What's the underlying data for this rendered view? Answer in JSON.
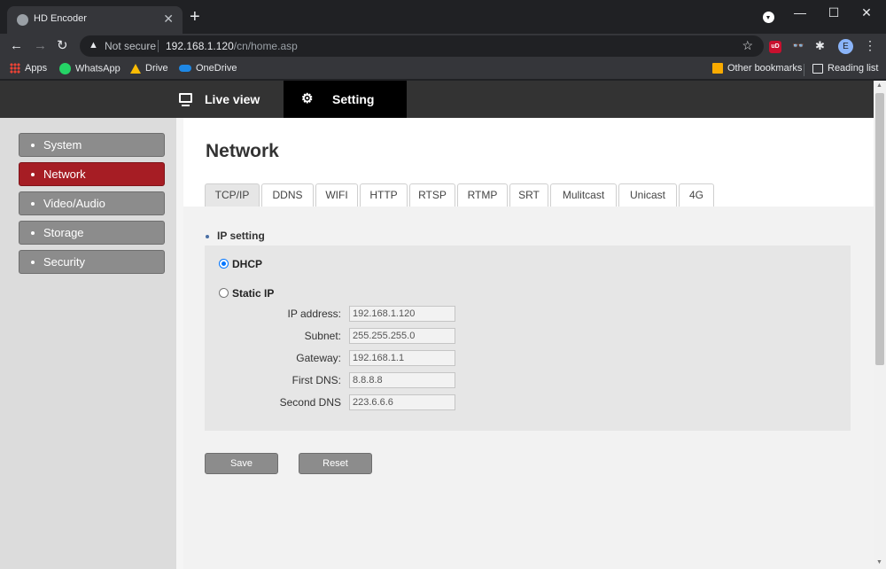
{
  "browser": {
    "tab_title": "HD Encoder",
    "tab_close": "✕",
    "new_tab": "+",
    "window_controls": {
      "minimize": "—",
      "maximize": "☐",
      "close": "✕"
    },
    "nav": {
      "back": "←",
      "forward": "→",
      "reload": "↻"
    },
    "address": {
      "warning_icon": "▲",
      "security_label": "Not secure",
      "host": "192.168.1.120",
      "path": "/cn/home.asp",
      "star": "☆"
    },
    "extensions": {
      "ublock": "uD",
      "glasses": "👓",
      "puzzle": "✱",
      "avatar": "E",
      "menu": "⋮"
    },
    "bookmarks": [
      {
        "label": "Apps",
        "icon": "apps-grid-icon"
      },
      {
        "label": "WhatsApp",
        "icon": "whatsapp-icon"
      },
      {
        "label": "Drive",
        "icon": "google-drive-icon"
      },
      {
        "label": "OneDrive",
        "icon": "onedrive-icon"
      }
    ],
    "other_bookmarks": "Other bookmarks",
    "reading_list": "Reading list"
  },
  "topnav": {
    "live_view": "Live view",
    "setting": "Setting"
  },
  "sidebar": {
    "items": [
      {
        "label": "System",
        "active": false
      },
      {
        "label": "Network",
        "active": true
      },
      {
        "label": "Video/Audio",
        "active": false
      },
      {
        "label": "Storage",
        "active": false
      },
      {
        "label": "Security",
        "active": false
      }
    ]
  },
  "main": {
    "title": "Network",
    "tabs": [
      "TCP/IP",
      "DDNS",
      "WIFI",
      "HTTP",
      "RTSP",
      "RTMP",
      "SRT",
      "Mulitcast",
      "Unicast",
      "4G"
    ],
    "active_tab": "TCP/IP",
    "section_label": "IP setting",
    "dhcp_label": "DHCP",
    "static_label": "Static IP",
    "selected_mode": "DHCP",
    "fields": [
      {
        "label": "IP address:",
        "value": "192.168.1.120"
      },
      {
        "label": "Subnet:",
        "value": "255.255.255.0"
      },
      {
        "label": "Gateway:",
        "value": "192.168.1.1"
      },
      {
        "label": "First DNS:",
        "value": "8.8.8.8"
      },
      {
        "label": "Second DNS",
        "value": "223.6.6.6"
      }
    ],
    "save_label": "Save",
    "reset_label": "Reset"
  },
  "colors": {
    "active_sidebar": "#a61d24",
    "sidebar_button": "#8c8c8c",
    "topnav": "#333333",
    "radio_accent": "#0075ff"
  }
}
